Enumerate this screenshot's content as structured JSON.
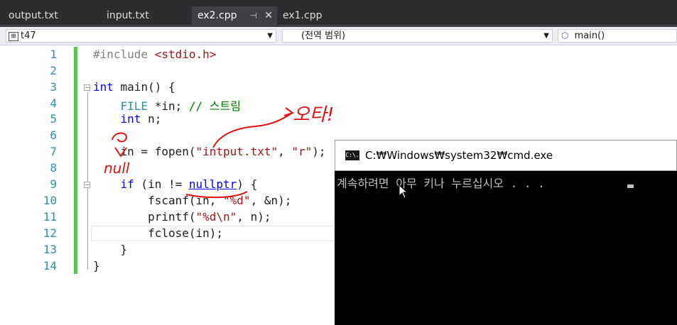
{
  "tabs": [
    {
      "label": "output.txt"
    },
    {
      "label": "input.txt"
    },
    {
      "label": "ex2.cpp",
      "active": true,
      "pin": "⊣",
      "close": "✕"
    },
    {
      "label": "ex1.cpp"
    }
  ],
  "navbar": {
    "project": "t47",
    "scope": "(전역 범위)",
    "function": "main()"
  },
  "line_numbers": [
    "1",
    "2",
    "3",
    "4",
    "5",
    "6",
    "7",
    "8",
    "9",
    "10",
    "11",
    "12",
    "13",
    "14"
  ],
  "code": {
    "l1a": "#include ",
    "l1b": "<stdio.h>",
    "l3a": "int",
    "l3b": " main() {",
    "l4a": "    FILE",
    "l4b": " *in; ",
    "l4c": "// 스트림",
    "l5a": "    int",
    "l5b": " n;",
    "l7a": "    in = fopen(",
    "l7b": "\"intput.txt\"",
    "l7c": ", ",
    "l7d": "\"r\"",
    "l7e": ");",
    "l9a": "    if",
    "l9b": " (in != ",
    "l9c": "nullptr",
    "l9d": ") {",
    "l10a": "        fscanf(in, ",
    "l10b": "\"%d\"",
    "l10c": ", &n);",
    "l11a": "        printf(",
    "l11b": "\"%d\\n\"",
    "l11c": ", n);",
    "l12": "        fclose(in);",
    "l13": "    }",
    "l14": "}"
  },
  "annotations": {
    "typo": "오타!",
    "null": "null"
  },
  "cmd": {
    "title": "C:₩Windows₩system32₩cmd.exe",
    "icon_text": "C:\\.",
    "output": "계속하려면 아무 키나 누르십시오 . . ."
  },
  "icons": [
    "pin-icon",
    "close-icon",
    "class-icon",
    "function-icon",
    "dropdown-arrow-icon",
    "cmd-icon",
    "mouse-cursor-icon"
  ]
}
